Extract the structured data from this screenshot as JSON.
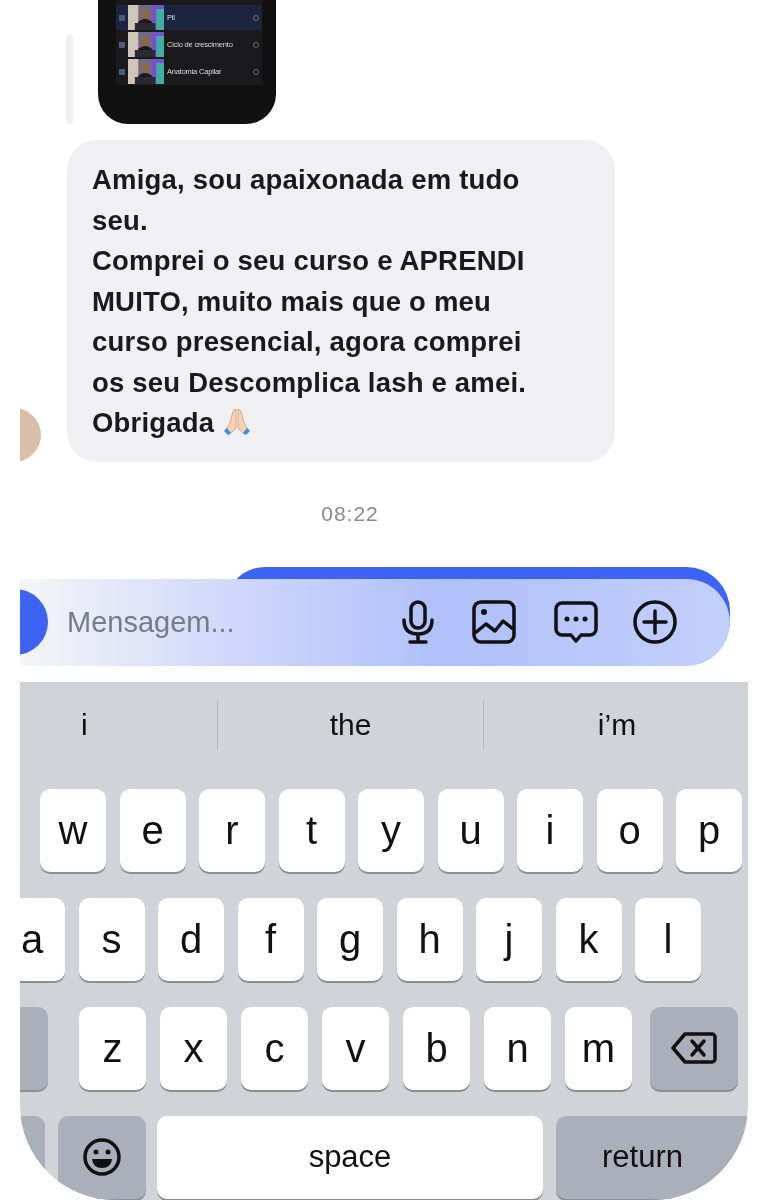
{
  "shared_post": {
    "items": [
      {
        "title": "Pil",
        "selected": true
      },
      {
        "title": "Ciclo de crescimento",
        "selected": false
      },
      {
        "title": "Anatomia Capilar",
        "selected": false
      }
    ]
  },
  "message": {
    "paragraphs": [
      "Amiga, sou apaixonada em tudo seu.",
      "Comprei o seu curso e APRENDI MUITO, muito mais que o meu curso presencial, agora comprei os seu Descomplica lash e amei.",
      "Obrigada"
    ]
  },
  "timestamp": "08:22",
  "composer": {
    "placeholder": "Mensagem..."
  },
  "keyboard": {
    "suggestions": [
      "i",
      "the",
      "i’m"
    ],
    "letter_rows": [
      [
        {
          "kind": "letter",
          "label": "w"
        },
        {
          "kind": "letter",
          "label": "e"
        },
        {
          "kind": "letter",
          "label": "r"
        },
        {
          "kind": "letter",
          "label": "t"
        },
        {
          "kind": "letter",
          "label": "y"
        },
        {
          "kind": "letter",
          "label": "u"
        },
        {
          "kind": "letter",
          "label": "i"
        },
        {
          "kind": "letter",
          "label": "o"
        },
        {
          "kind": "letter",
          "label": "p"
        }
      ],
      [
        {
          "kind": "letter",
          "label": "a"
        },
        {
          "kind": "letter",
          "label": "s"
        },
        {
          "kind": "letter",
          "label": "d"
        },
        {
          "kind": "letter",
          "label": "f"
        },
        {
          "kind": "letter",
          "label": "g"
        },
        {
          "kind": "letter",
          "label": "h"
        },
        {
          "kind": "letter",
          "label": "j"
        },
        {
          "kind": "letter",
          "label": "k"
        },
        {
          "kind": "letter",
          "label": "l"
        }
      ],
      [
        {
          "kind": "shift"
        },
        {
          "kind": "letter",
          "label": "z"
        },
        {
          "kind": "letter",
          "label": "x"
        },
        {
          "kind": "letter",
          "label": "c"
        },
        {
          "kind": "letter",
          "label": "v"
        },
        {
          "kind": "letter",
          "label": "b"
        },
        {
          "kind": "letter",
          "label": "n"
        },
        {
          "kind": "letter",
          "label": "m"
        },
        {
          "kind": "delete"
        }
      ]
    ],
    "bottom_row": [
      {
        "kind": "numbers"
      },
      {
        "kind": "emoji"
      },
      {
        "kind": "space",
        "label": "space"
      },
      {
        "kind": "return",
        "label": "return"
      }
    ]
  }
}
